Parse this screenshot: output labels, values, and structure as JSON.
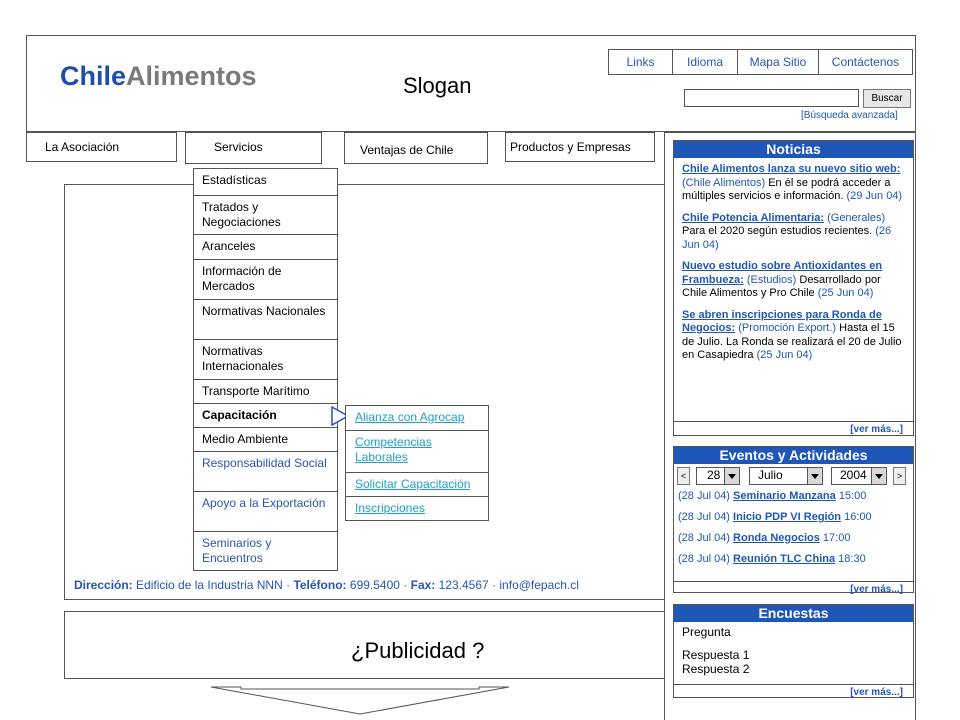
{
  "header": {
    "logo_part1": "Chile",
    "logo_part2": "Alimentos",
    "slogan": "Slogan",
    "top_links": [
      "Links",
      "Idioma",
      "Mapa Sitio",
      "Contáctenos"
    ],
    "search_button": "Buscar",
    "search_value": "",
    "advanced_search": "[Búsqueda avanzada]"
  },
  "nav": {
    "tabs": [
      "La Asociación",
      "Servicios",
      "Ventajas de Chile",
      "Productos y Empresas"
    ]
  },
  "menu": {
    "items": [
      "Estadísticas",
      "Tratados y Negociaciones",
      "Aranceles",
      "Información de Mercados",
      "Normativas Nacionales",
      "Normativas Internacionales",
      "Transporte Marítimo",
      "Capacitación",
      "Medio Ambiente",
      "Responsabilidad Social",
      "Apoyo a la Exportación",
      "Seminarios y Encuentros"
    ],
    "submenu": [
      "Alianza con Agrocap",
      "Competencias Laborales",
      "Solicitar Capacitación",
      "Inscripciones"
    ]
  },
  "footer": {
    "address_label": "Dirección:",
    "address_value": "Edificio de la Industria NNN",
    "phone_label": "Teléfono:",
    "phone_value": "699.5400",
    "fax_label": "Fax:",
    "fax_value": "123.4567",
    "email": "info@fepach.cl"
  },
  "ad": {
    "text": "¿Publicidad ?"
  },
  "news": {
    "title": "Noticias",
    "more": "[ver más...]",
    "items": [
      {
        "title": "Chile Alimentos lanza su nuevo sitio web:",
        "category": "(Chile Alimentos)",
        "body": "En él se podrá acceder a múltiples servicios e información.",
        "date": "(29 Jun 04)"
      },
      {
        "title": "Chile Potencia Alimentaria:",
        "category": "(Generales)",
        "body": "Para el 2020 según estudios recientes.",
        "date": "(26 Jun 04)"
      },
      {
        "title": "Nuevo estudio sobre Antioxidantes en Frambueza:",
        "category": "(Estudios)",
        "body": "Desarrollado por Chile Alimentos y Pro Chile",
        "date": "(25 Jun 04)"
      },
      {
        "title": "Se abren inscripciones para Ronda de Negocios:",
        "category": "(Promoción Export.)",
        "body": "Hasta el 15 de Julio. La Ronda se realizará el 20 de Julio en Casapiedra",
        "date": "(25 Jun 04)"
      }
    ]
  },
  "events": {
    "title": "Eventos y Actividades",
    "more": "[ver más...]",
    "prev": "<",
    "next": ">",
    "day": "28",
    "month": "Julio",
    "year": "2004",
    "items": [
      {
        "date": "(28 Jul 04)",
        "name": "Seminario Manzana",
        "time": "15:00"
      },
      {
        "date": "(28 Jul 04)",
        "name": "Inicio PDP VI Región",
        "time": "16:00"
      },
      {
        "date": "(28 Jul 04)",
        "name": "Ronda Negocios",
        "time": "17:00"
      },
      {
        "date": "(28 Jul 04)",
        "name": "Reunión TLC China",
        "time": "18:30"
      }
    ]
  },
  "polls": {
    "title": "Encuestas",
    "more": "[ver más...]",
    "question": "Pregunta",
    "answers": [
      "Respuesta 1",
      "Respuesta 2"
    ]
  }
}
